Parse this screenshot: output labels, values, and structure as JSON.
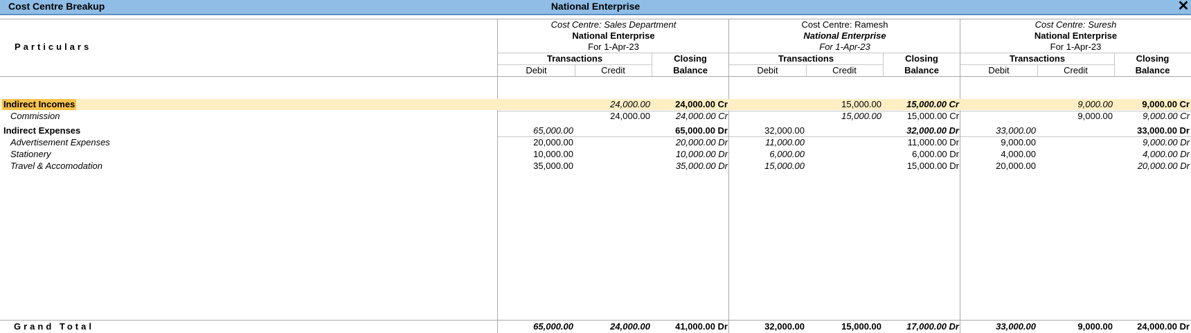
{
  "window": {
    "title": "Cost Centre Breakup",
    "company": "National Enterprise",
    "close_symbol": "✕"
  },
  "header": {
    "particulars_label": "Particulars",
    "transactions_label": "Transactions",
    "closing_label": "Closing",
    "balance_label": "Balance",
    "debit_label": "Debit",
    "credit_label": "Credit"
  },
  "cost_centres": [
    {
      "title": "Cost Centre: Sales Department",
      "company": "National Enterprise",
      "period": "For 1-Apr-23"
    },
    {
      "title": "Cost Centre: Ramesh",
      "company": "National Enterprise",
      "period": "For 1-Apr-23"
    },
    {
      "title": "Cost Centre: Suresh",
      "company": "National Enterprise",
      "period": "For 1-Apr-23"
    }
  ],
  "rows": [
    {
      "label": "Indirect Incomes",
      "type": "group",
      "values": [
        {
          "debit": "",
          "credit": "24,000.00",
          "closing": "24,000.00 Cr"
        },
        {
          "debit": "",
          "credit": "15,000.00",
          "closing": "15,000.00 Cr"
        },
        {
          "debit": "",
          "credit": "9,000.00",
          "closing": "9,000.00 Cr"
        }
      ]
    },
    {
      "label": "Commission",
      "type": "ledger",
      "values": [
        {
          "debit": "",
          "credit": "24,000.00",
          "closing": "24,000.00 Cr"
        },
        {
          "debit": "",
          "credit": "15,000.00",
          "closing": "15,000.00 Cr"
        },
        {
          "debit": "",
          "credit": "9,000.00",
          "closing": "9,000.00 Cr"
        }
      ]
    },
    {
      "label": "Indirect Expenses",
      "type": "group",
      "values": [
        {
          "debit": "65,000.00",
          "credit": "",
          "closing": "65,000.00 Dr"
        },
        {
          "debit": "32,000.00",
          "credit": "",
          "closing": "32,000.00 Dr"
        },
        {
          "debit": "33,000.00",
          "credit": "",
          "closing": "33,000.00 Dr"
        }
      ]
    },
    {
      "label": "Advertisement Expenses",
      "type": "ledger",
      "values": [
        {
          "debit": "20,000.00",
          "credit": "",
          "closing": "20,000.00 Dr"
        },
        {
          "debit": "11,000.00",
          "credit": "",
          "closing": "11,000.00 Dr"
        },
        {
          "debit": "9,000.00",
          "credit": "",
          "closing": "9,000.00 Dr"
        }
      ]
    },
    {
      "label": "Stationery",
      "type": "ledger",
      "values": [
        {
          "debit": "10,000.00",
          "credit": "",
          "closing": "10,000.00 Dr"
        },
        {
          "debit": "6,000.00",
          "credit": "",
          "closing": "6,000.00 Dr"
        },
        {
          "debit": "4,000.00",
          "credit": "",
          "closing": "4,000.00 Dr"
        }
      ]
    },
    {
      "label": "Travel & Accomodation",
      "type": "ledger",
      "values": [
        {
          "debit": "35,000.00",
          "credit": "",
          "closing": "35,000.00 Dr"
        },
        {
          "debit": "15,000.00",
          "credit": "",
          "closing": "15,000.00 Dr"
        },
        {
          "debit": "20,000.00",
          "credit": "",
          "closing": "20,000.00 Dr"
        }
      ]
    }
  ],
  "grand_total": {
    "label": "Grand Total",
    "values": [
      {
        "debit": "65,000.00",
        "credit": "24,000.00",
        "closing": "41,000.00 Dr"
      },
      {
        "debit": "32,000.00",
        "credit": "15,000.00",
        "closing": "17,000.00 Dr"
      },
      {
        "debit": "33,000.00",
        "credit": "9,000.00",
        "closing": "24,000.00 Dr"
      }
    ]
  }
}
